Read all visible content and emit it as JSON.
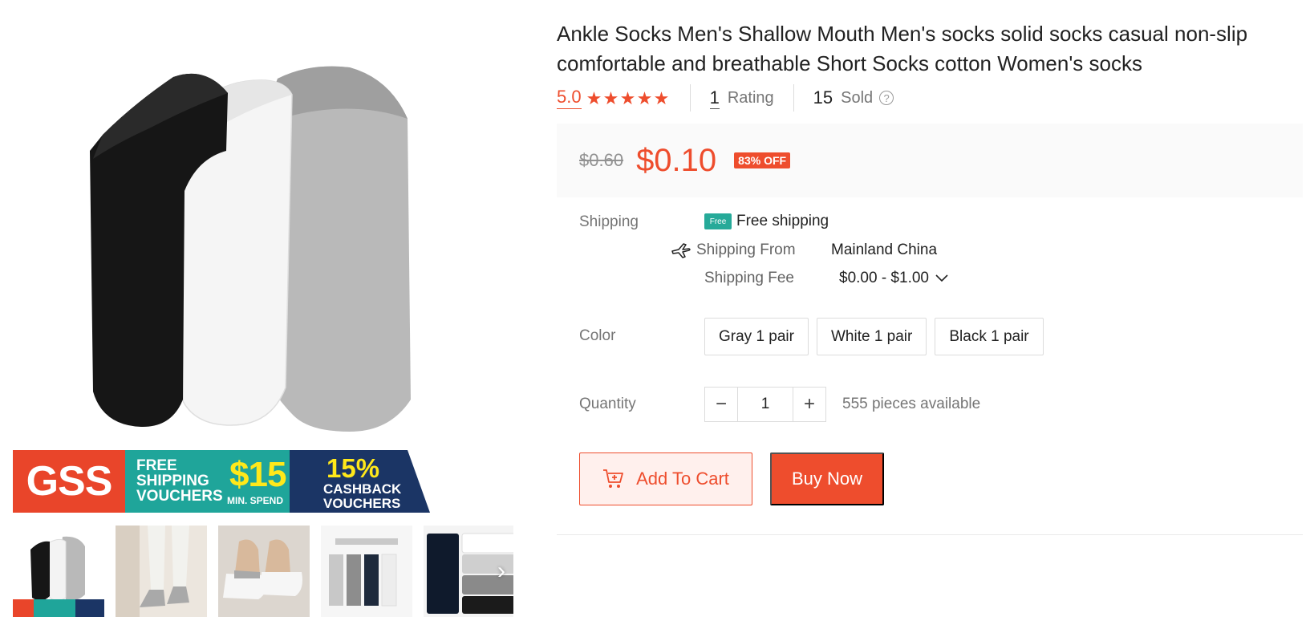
{
  "gallery": {
    "main_image_alt": "Three ankle socks: black, white, gray",
    "banner": {
      "left_text": "GSS",
      "mid_line1": "FREE",
      "mid_line2": "SHIPPING",
      "mid_line3": "VOUCHERS",
      "mid_amount": "$15",
      "mid_min_spend": "MIN. SPEND",
      "right_pct": "15%",
      "right_line1": "CASHBACK",
      "right_line2": "VOUCHERS"
    },
    "thumbnails": [
      {
        "name": "thumb-1-socks-pack",
        "active": true
      },
      {
        "name": "thumb-2-legs-socks"
      },
      {
        "name": "thumb-3-shoes-socks"
      },
      {
        "name": "thumb-4-socks-display"
      },
      {
        "name": "thumb-5-folded-socks"
      }
    ],
    "thumb_next_icon": "chevron-right-icon"
  },
  "product": {
    "title": "Ankle Socks Men's Shallow Mouth Men's socks solid socks casual non-slip comfortable and breathable Short Socks cotton Women's socks",
    "rating_score": "5.0",
    "stars": 5,
    "rating_count": "1",
    "rating_label": "Rating",
    "sold_count": "15",
    "sold_label": "Sold",
    "original_price": "$0.60",
    "price": "$0.10",
    "discount_badge": "83% OFF"
  },
  "shipping": {
    "label": "Shipping",
    "free_icon_text": "Free",
    "free_shipping": "Free shipping",
    "from_label": "Shipping From",
    "from_value": "Mainland China",
    "fee_label": "Shipping Fee",
    "fee_value": "$0.00 - $1.00"
  },
  "color": {
    "label": "Color",
    "options": [
      "Gray 1 pair",
      "White 1 pair",
      "Black 1 pair"
    ]
  },
  "quantity": {
    "label": "Quantity",
    "minus": "−",
    "plus": "+",
    "value": "1",
    "available": "555 pieces available"
  },
  "actions": {
    "add_to_cart": "Add To Cart",
    "buy_now": "Buy Now"
  },
  "colors": {
    "accent": "#ee4d2d",
    "teal": "#26aa99"
  }
}
